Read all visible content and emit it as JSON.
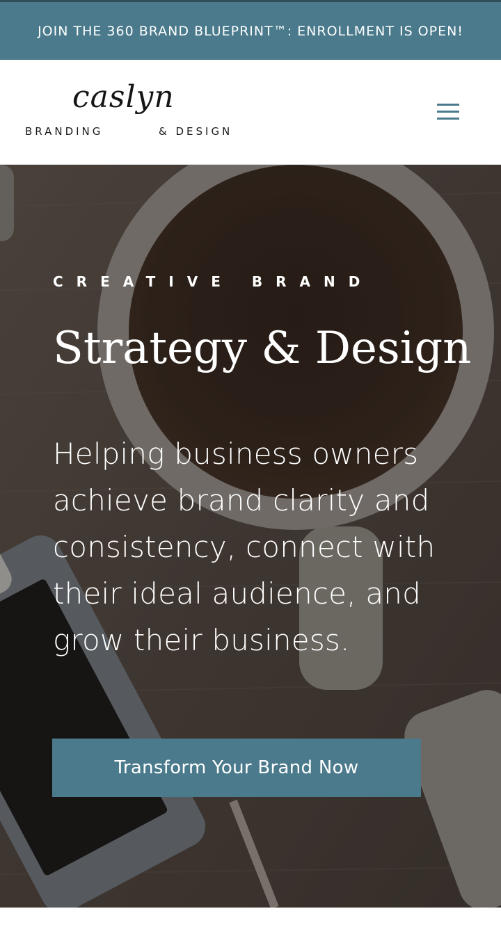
{
  "announcement": {
    "text": "JOIN THE 360 BRAND BLUEPRINT™: ENROLLMENT IS OPEN!"
  },
  "header": {
    "logo": {
      "script": "caslyn",
      "branding": "BRANDING",
      "design": "& DESIGN"
    },
    "menu_icon": "hamburger-menu-icon"
  },
  "hero": {
    "eyebrow": "CREATIVE BRAND",
    "title": "Strategy & Design",
    "subtitle": "Helping business owners achieve brand clarity and consistency, connect with their ideal audience, and grow their business.",
    "cta_label": "Transform Your Brand Now"
  },
  "colors": {
    "accent": "#4a7a8c",
    "announce_border": "#2f4e5a",
    "text_dark": "#151515",
    "white": "#ffffff"
  }
}
